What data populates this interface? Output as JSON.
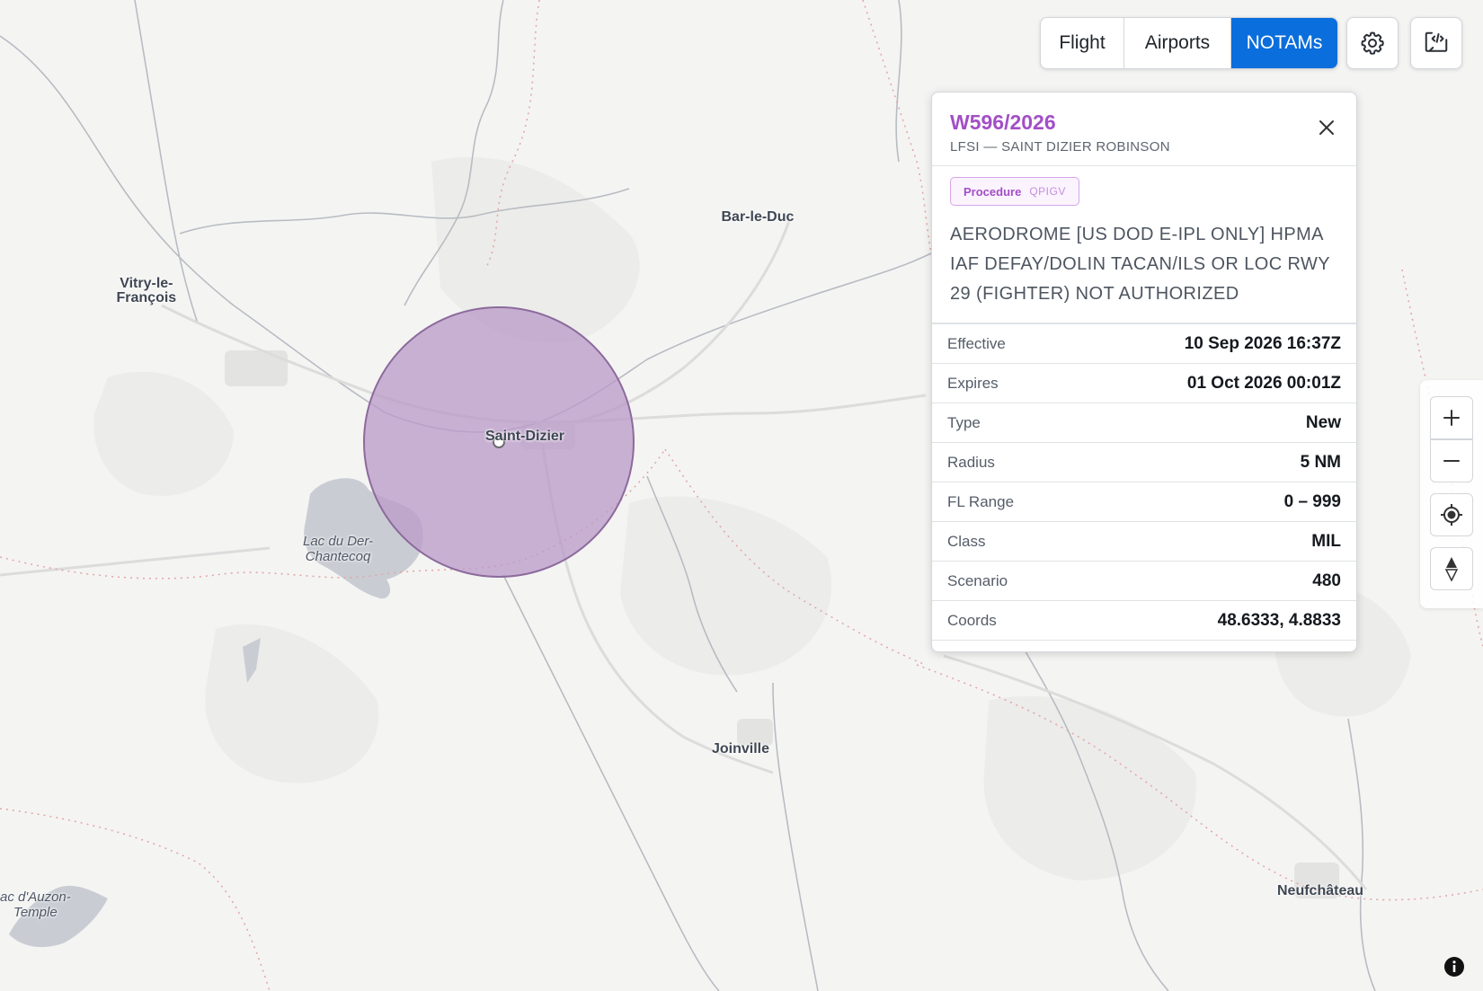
{
  "map": {
    "places": [
      {
        "name": "Bar-le-Duc"
      },
      {
        "name": "Vitry-le-\nFrançois"
      },
      {
        "name": "Saint-Dizier"
      },
      {
        "name": "Joinville"
      },
      {
        "name": "Neufchâteau"
      }
    ],
    "water": [
      {
        "name": "Lac du Der-\nChantecoq"
      },
      {
        "name": "ac d'Auzon-\nTemple"
      }
    ],
    "notam_circle_color": "#b99ac8",
    "notam_circle_stroke": "#8c6a9c"
  },
  "tabs": {
    "flight": "Flight",
    "airports": "Airports",
    "notams": "NOTAMs",
    "active": "notams",
    "accent": "#0a6edc"
  },
  "notam": {
    "id": "W596/2026",
    "location": "LFSI — SAINT DIZIER ROBINSON",
    "category": "Procedure",
    "qcode": "QPIGV",
    "text": "AERODROME [US DOD E-IPL ONLY] HPMA IAF DEFAY/DOLIN TACAN/ILS OR LOC RWY 29 (FIGHTER) NOT AUTHORIZED",
    "accent": "#a24fc6",
    "fields": [
      {
        "label": "Effective",
        "value": "10 Sep 2026 16:37Z"
      },
      {
        "label": "Expires",
        "value": "01 Oct 2026 00:01Z"
      },
      {
        "label": "Type",
        "value": "New"
      },
      {
        "label": "Radius",
        "value": "5 NM"
      },
      {
        "label": "FL Range",
        "value": "0 – 999"
      },
      {
        "label": "Class",
        "value": "MIL"
      },
      {
        "label": "Scenario",
        "value": "480"
      },
      {
        "label": "Coords",
        "value": "48.6333, 4.8833"
      }
    ]
  }
}
